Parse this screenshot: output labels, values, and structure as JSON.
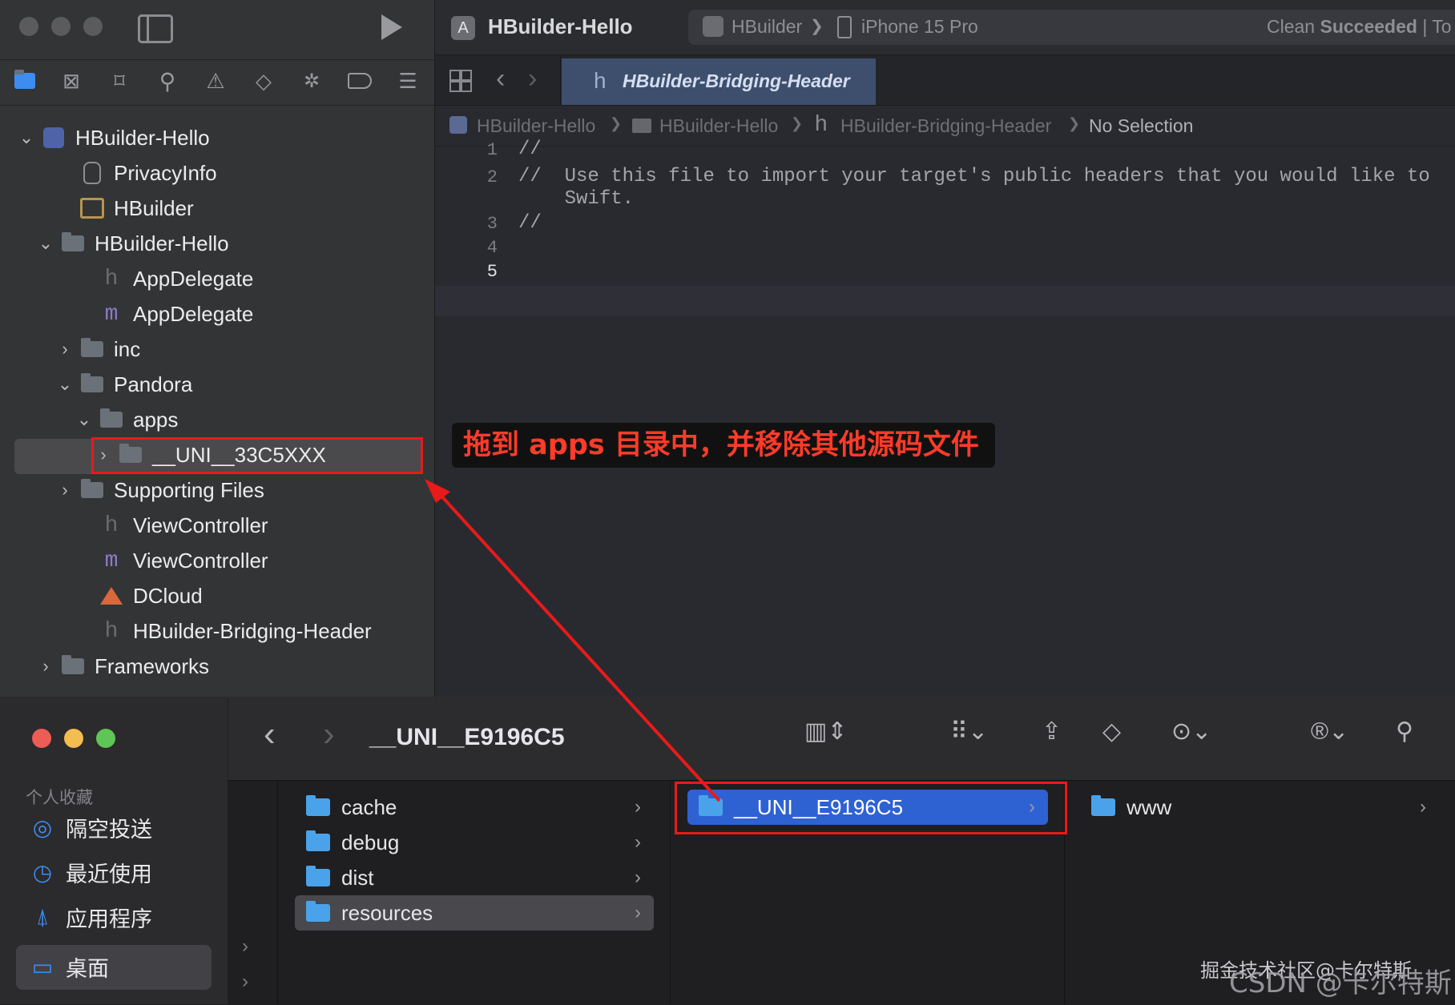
{
  "xcode": {
    "window_title": "HBuilder-Hello",
    "scheme": "HBuilder",
    "scheme_sep": "❯",
    "device": "iPhone 15 Pro",
    "status_prefix": "Clean ",
    "status_strong": "Succeeded",
    "status_suffix": " | To",
    "tab_label": "HBuilder-Bridging-Header",
    "tab_letter": "h",
    "jump_bar": {
      "items": [
        "HBuilder-Hello",
        "HBuilder-Hello",
        "HBuilder-Bridging-Header"
      ],
      "sep": "❯",
      "last": "No Selection"
    },
    "tree": [
      {
        "label": "HBuilder-Hello",
        "chevron": "⌄",
        "icon": "project-icon"
      },
      {
        "label": "PrivacyInfo",
        "chevron": "",
        "icon": "hand-icon"
      },
      {
        "label": "HBuilder",
        "chevron": "",
        "icon": "assets-icon"
      },
      {
        "label": "HBuilder-Hello",
        "chevron": "⌄",
        "icon": "folder-icon"
      },
      {
        "label": "AppDelegate",
        "chevron": "",
        "icon": "h-file-icon"
      },
      {
        "label": "AppDelegate",
        "chevron": "",
        "icon": "m-file-icon"
      },
      {
        "label": "inc",
        "chevron": "›",
        "icon": "folder-icon"
      },
      {
        "label": "Pandora",
        "chevron": "⌄",
        "icon": "folder-icon"
      },
      {
        "label": "apps",
        "chevron": "⌄",
        "icon": "folder-icon"
      },
      {
        "label": "__UNI__33C5XXX",
        "chevron": "›",
        "icon": "folder-icon"
      },
      {
        "label": "Supporting Files",
        "chevron": "›",
        "icon": "folder-icon"
      },
      {
        "label": "ViewController",
        "chevron": "",
        "icon": "h-file-icon"
      },
      {
        "label": "ViewController",
        "chevron": "",
        "icon": "m-file-icon"
      },
      {
        "label": "DCloud",
        "chevron": "",
        "icon": "swift-icon"
      },
      {
        "label": "HBuilder-Bridging-Header",
        "chevron": "",
        "icon": "h-file-icon"
      },
      {
        "label": "Frameworks",
        "chevron": "›",
        "icon": "folder-icon"
      }
    ],
    "code_lines": [
      {
        "n": "1",
        "text": "//"
      },
      {
        "n": "2",
        "text": "//  Use this file to import your target's public headers that you would like to"
      },
      {
        "n": "",
        "text": "    Swift."
      },
      {
        "n": "3",
        "text": "//"
      },
      {
        "n": "4",
        "text": ""
      },
      {
        "n": "5",
        "text": ""
      }
    ],
    "icon_glyphs": {
      "h": "h",
      "m": "m"
    }
  },
  "annotation": {
    "text": "拖到 apps 目录中，并移除其他源码文件",
    "color": "#ff3b2a"
  },
  "finder": {
    "path_title": "__UNI__E9196C5",
    "sidebar_heading": "个人收藏",
    "sidebar_items": [
      {
        "label": "隔空投送",
        "icon": "airdrop-icon"
      },
      {
        "label": "最近使用",
        "icon": "clock-icon"
      },
      {
        "label": "应用程序",
        "icon": "apps-icon"
      },
      {
        "label": "桌面",
        "icon": "desktop-icon"
      }
    ],
    "column1": [
      {
        "label": "cache"
      },
      {
        "label": "debug"
      },
      {
        "label": "dist"
      },
      {
        "label": "resources"
      }
    ],
    "column2": [
      {
        "label": "__UNI__E9196C5"
      }
    ],
    "column3": [
      {
        "label": "www"
      }
    ]
  },
  "watermark": {
    "line1": "掘金技术社区@卡尔特斯",
    "line2": "CSDN @卡尔特斯"
  }
}
